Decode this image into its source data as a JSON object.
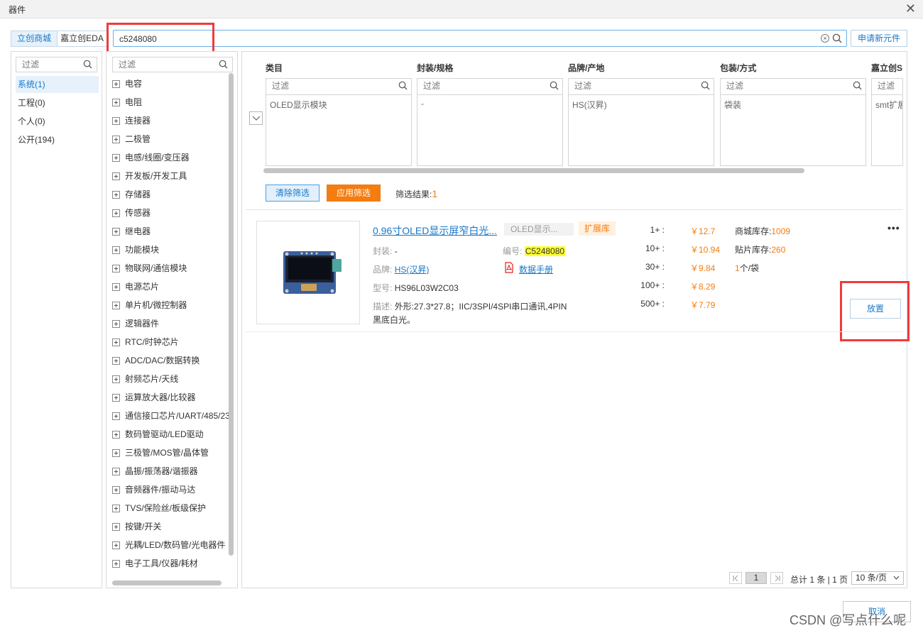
{
  "window": {
    "title": "器件",
    "close_glyph": "✕"
  },
  "source_tabs": [
    "立创商城",
    "嘉立创EDA"
  ],
  "search": {
    "value": "c5248080",
    "placeholder": ""
  },
  "apply_new_part_label": "申请新元件",
  "library": {
    "filter_placeholder": "过滤",
    "items": [
      {
        "label": "系统(1)",
        "selected": true
      },
      {
        "label": "工程(0)",
        "selected": false
      },
      {
        "label": "个人(0)",
        "selected": false
      },
      {
        "label": "公开(194)",
        "selected": false
      }
    ]
  },
  "categories": {
    "filter_placeholder": "过滤",
    "items": [
      "电容",
      "电阻",
      "连接器",
      "二极管",
      "电感/线圈/变压器",
      "开发板/开发工具",
      "存储器",
      "传感器",
      "继电器",
      "功能模块",
      "物联网/通信模块",
      "电源芯片",
      "单片机/微控制器",
      "逻辑器件",
      "RTC/时钟芯片",
      "ADC/DAC/数据转换",
      "射频芯片/天线",
      "运算放大器/比较器",
      "通信接口芯片/UART/485/23",
      "数码管驱动/LED驱动",
      "三极管/MOS管/晶体管",
      "晶振/振荡器/谐振器",
      "音频器件/振动马达",
      "TVS/保险丝/板级保护",
      "按键/开关",
      "光耦/LED/数码管/光电器件",
      "电子工具/仪器/耗材"
    ]
  },
  "facets": [
    {
      "title": "类目",
      "filter_placeholder": "过滤",
      "value": "OLED显示模块"
    },
    {
      "title": "封装/规格",
      "filter_placeholder": "过滤",
      "value": "-"
    },
    {
      "title": "品牌/产地",
      "filter_placeholder": "过滤",
      "value": "HS(汉昇)"
    },
    {
      "title": "包装/方式",
      "filter_placeholder": "过滤",
      "value": "袋装"
    },
    {
      "title": "嘉立创S",
      "filter_placeholder": "过滤",
      "value": "smt扩展"
    }
  ],
  "filter_actions": {
    "clear": "清除筛选",
    "apply": "应用筛选",
    "result_label": "筛选结果:",
    "result_count": "1"
  },
  "product": {
    "name": "0.96寸OLED显示屏窄白光...",
    "category_tag": "OLED显示...",
    "library_tag": "扩展库",
    "package_label": "封装:",
    "package_value": "-",
    "code_label": "编号:",
    "code_value": "C5248080",
    "brand_label": "品牌:",
    "brand_value": "HS(汉昇)",
    "datasheet_label": "数据手册",
    "model_label": "型号:",
    "model_value": "HS96L03W2C03",
    "desc_label": "描述:",
    "desc_line1": "外形:27.3*27.8；IIC/3SPI/4SPI串口通讯,4PIN",
    "desc_line2": "黑底白光。",
    "price_breaks": [
      {
        "qty": "1+ :",
        "price": "￥12.7"
      },
      {
        "qty": "10+ :",
        "price": "￥10.94"
      },
      {
        "qty": "30+ :",
        "price": "￥9.84"
      },
      {
        "qty": "100+ :",
        "price": "￥8.29"
      },
      {
        "qty": "500+ :",
        "price": "￥7.79"
      }
    ],
    "mall_stock_label": "商城库存:",
    "mall_stock_value": "1009",
    "smt_stock_label": "贴片库存:",
    "smt_stock_value": "260",
    "pack_qty": "1",
    "pack_unit": "个/袋",
    "more_glyph": "•••",
    "place_label": "放置"
  },
  "pagination": {
    "current": "1",
    "summary": "总计 1 条 | 1 页",
    "page_size": "10 条/页"
  },
  "cancel_label": "取消",
  "watermark": "CSDN @写点什么呢",
  "colors": {
    "accent": "#1878c8",
    "orange": "#f57c0f",
    "highlight_box": "#ef3b3b",
    "code_highlight": "#ffff33"
  }
}
